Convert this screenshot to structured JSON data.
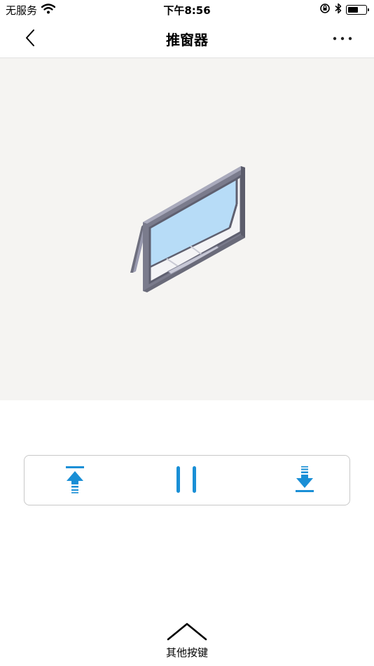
{
  "status_bar": {
    "carrier": "无服务",
    "time": "下午8:56",
    "battery_level": 0.6
  },
  "nav": {
    "title": "推窗器",
    "back_icon": "chevron-left-icon",
    "more_icon": "more-dots-icon"
  },
  "controls": {
    "open_icon": "open-to-top-icon",
    "pause_icon": "pause-icon",
    "close_icon": "close-to-bottom-icon",
    "accent_color": "#1a8fd6"
  },
  "footer": {
    "more_keys_label": "其他按键",
    "expand_icon": "chevron-up-icon"
  }
}
